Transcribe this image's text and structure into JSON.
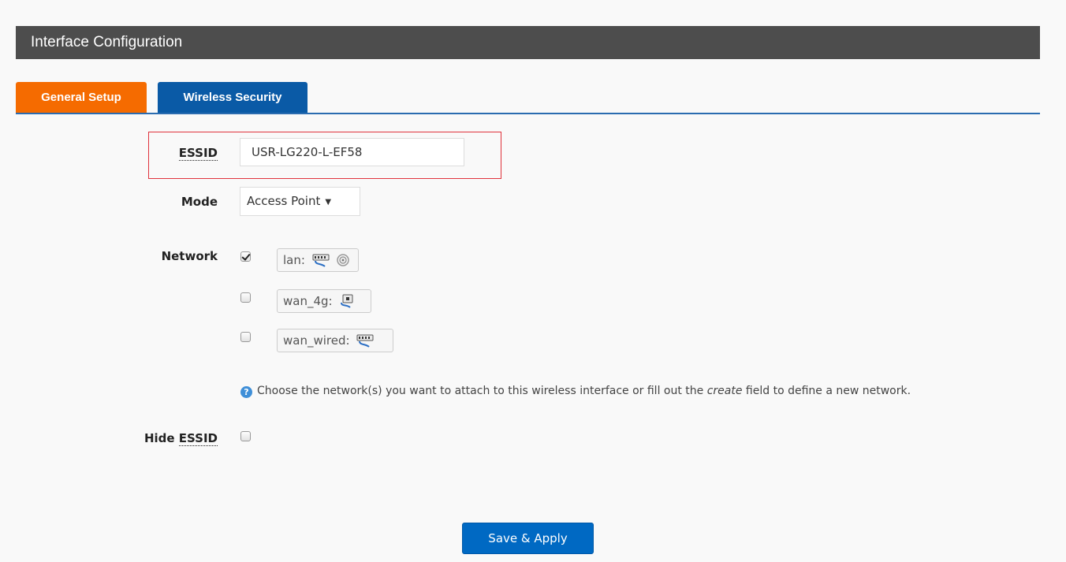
{
  "header": {
    "title": "Interface Configuration"
  },
  "tabs": [
    {
      "label": "General Setup",
      "color": "#f56b00"
    },
    {
      "label": "Wireless Security",
      "color": "#0a5aa6"
    }
  ],
  "form": {
    "essid": {
      "label": "ESSID",
      "value": "USR-LG220-L-EF58"
    },
    "mode": {
      "label": "Mode",
      "selected": "Access Point",
      "arrow": "▼"
    },
    "network": {
      "label": "Network",
      "options": [
        {
          "name": "lan:",
          "checked": true,
          "icons": [
            "ethernet-switch-icon",
            "wifi-icon"
          ]
        },
        {
          "name": "wan_4g:",
          "checked": false,
          "icons": [
            "ethernet-port-icon"
          ]
        },
        {
          "name": "wan_wired:",
          "checked": false,
          "icons": [
            "ethernet-switch-icon"
          ]
        }
      ],
      "help": {
        "before": "Choose the network(s) you want to attach to this wireless interface or fill out the ",
        "emphasis": "create",
        "after": " field to define a new network."
      }
    },
    "hide_essid": {
      "label_prefix": "Hide ",
      "label_abbr": "ESSID",
      "checked": false
    }
  },
  "actions": {
    "save_label": "Save & Apply"
  },
  "colors": {
    "highlight": "#e0323c",
    "accent": "#0069c3"
  }
}
